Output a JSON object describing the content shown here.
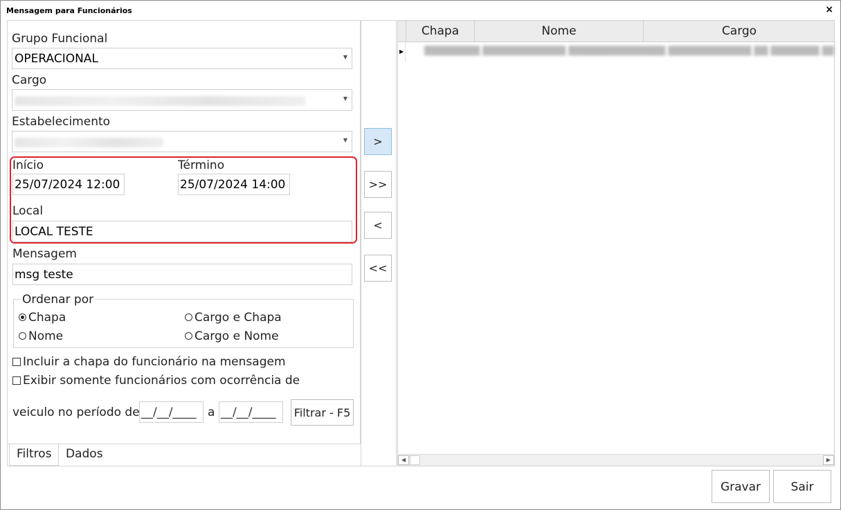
{
  "window": {
    "title": "Mensagem para Funcionários",
    "close_glyph": "×"
  },
  "filters": {
    "grupo_label": "Grupo Funcional",
    "grupo_value": "OPERACIONAL",
    "cargo_label": "Cargo",
    "estab_label": "Estabelecimento",
    "inicio_label": "Início",
    "inicio_value": "25/07/2024 12:00",
    "termino_label": "Término",
    "termino_value": "25/07/2024 14:00",
    "local_label": "Local",
    "local_value": "LOCAL TESTE",
    "mensagem_label": "Mensagem",
    "mensagem_value": "msg teste",
    "ordenar_label": "Ordenar por",
    "radio_chapa": "Chapa",
    "radio_nome": "Nome",
    "radio_cargo_chapa": "Cargo e Chapa",
    "radio_cargo_nome": "Cargo e Nome",
    "check_incluir": "Incluir a chapa do funcionário na mensagem",
    "check_exibir": "Exibir somente funcionários com ocorrência de",
    "veiculo_label": "veiculo no período de",
    "date_from": "__/__/____",
    "a_label": "a",
    "date_to": "__/__/____",
    "filtrar_button": "Filtrar - F5"
  },
  "tabs": {
    "filtros": "Filtros",
    "dados": "Dados"
  },
  "transfer": {
    "add_one": ">",
    "add_all": ">>",
    "remove_one": "<",
    "remove_all": "<<"
  },
  "grid": {
    "columns": [
      "Chapa",
      "Nome",
      "Cargo"
    ],
    "row_indicator": "▶"
  },
  "footer": {
    "gravar": "Gravar",
    "sair": "Sair"
  },
  "colors": {
    "highlight": "#e0202a",
    "active_button": "#d6e8f7"
  }
}
